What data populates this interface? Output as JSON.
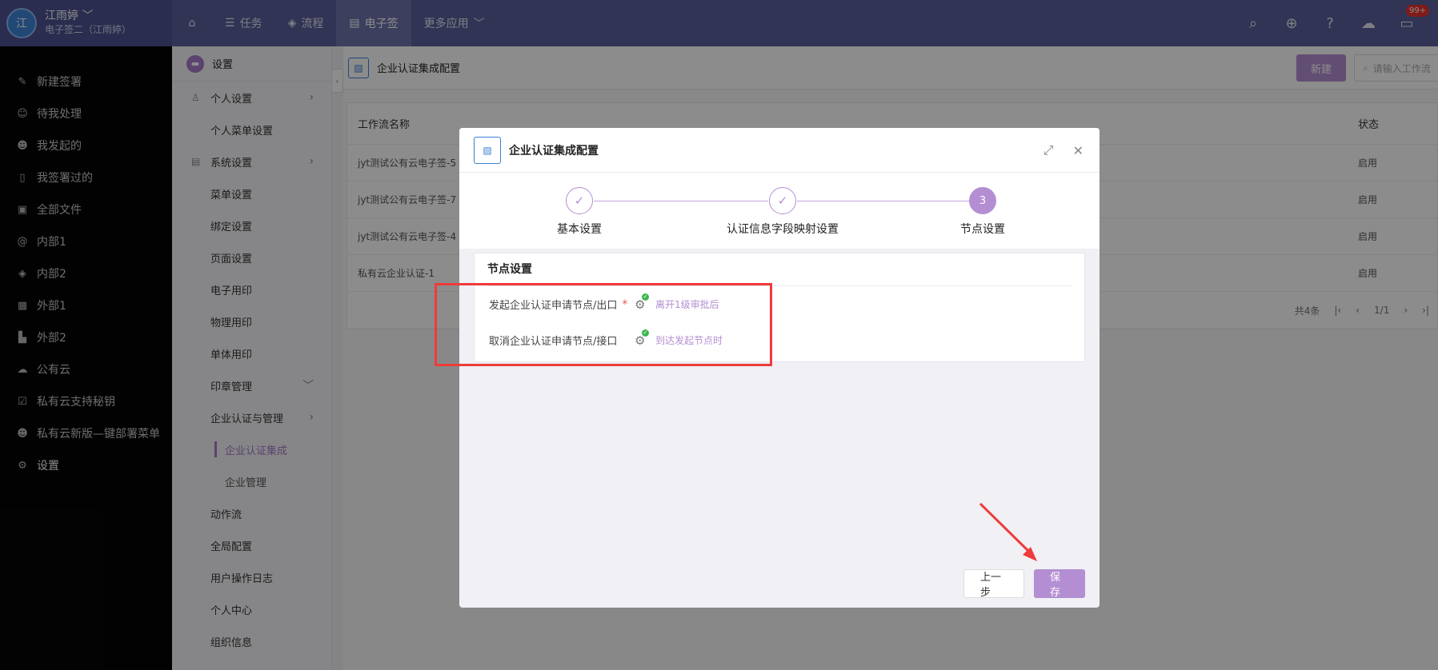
{
  "topbar": {
    "avatar_text": "江",
    "user_name": "江雨婷",
    "user_sub": "电子签二（江雨婷）",
    "nav": [
      {
        "label": ""
      },
      {
        "label": "任务"
      },
      {
        "label": "流程"
      },
      {
        "label": "电子签"
      },
      {
        "label": "更多应用"
      }
    ],
    "notification_badge": "99+"
  },
  "sidebar": {
    "items": [
      {
        "label": "新建签署",
        "icon": "pen-icon"
      },
      {
        "label": "待我处理",
        "icon": "user-clock-icon"
      },
      {
        "label": "我发起的",
        "icon": "user-send-icon"
      },
      {
        "label": "我签署过的",
        "icon": "document-icon"
      },
      {
        "label": "全部文件",
        "icon": "files-icon"
      },
      {
        "label": "内部1",
        "icon": "at-icon"
      },
      {
        "label": "内部2",
        "icon": "layers-icon"
      },
      {
        "label": "外部1",
        "icon": "grid-icon"
      },
      {
        "label": "外部2",
        "icon": "bar-chart-icon"
      },
      {
        "label": "公有云",
        "icon": "cloud-icon"
      },
      {
        "label": "私有云支持秘钥",
        "icon": "checkbox-icon"
      },
      {
        "label": "私有云新版—键部署菜单",
        "icon": "user-settings-icon"
      },
      {
        "label": "设置",
        "icon": "gear-icon"
      }
    ]
  },
  "settings_menu": {
    "header": "设置",
    "items": {
      "personal": "个人设置",
      "personal_menu": "个人菜单设置",
      "system": "系统设置",
      "menu": "菜单设置",
      "binding": "绑定设置",
      "page": "页面设置",
      "e_seal": "电子用印",
      "physical_seal": "物理用印",
      "single_seal": "单体用印",
      "seal_mgmt": "印章管理",
      "enterprise_auth": "企业认证与管理",
      "enterprise_auth_integration": "企业认证集成",
      "enterprise_mgmt": "企业管理",
      "action_flow": "动作流",
      "global_config": "全局配置",
      "user_log": "用户操作日志",
      "personal_center": "个人中心",
      "org_info": "组织信息"
    }
  },
  "main": {
    "title": "企业认证集成配置",
    "new_button": "新建",
    "search_placeholder": "请输入工作流",
    "table": {
      "headers": {
        "name": "工作流名称",
        "status": "状态"
      },
      "rows": [
        {
          "name": "jyt测试公有云电子签-5",
          "status": "启用"
        },
        {
          "name": "jyt测试公有云电子签-7",
          "status": "启用"
        },
        {
          "name": "jyt测试公有云电子签-4",
          "status": "启用"
        },
        {
          "name": "私有云企业认证-1",
          "status": "启用"
        }
      ]
    },
    "pager": {
      "total": "共4条",
      "page": "1/1"
    }
  },
  "modal": {
    "title": "企业认证集成配置",
    "steps": [
      {
        "label": "基本设置",
        "state": "done"
      },
      {
        "label": "认证信息字段映射设置",
        "state": "done"
      },
      {
        "label": "节点设置",
        "state": "current",
        "number": "3"
      }
    ],
    "section_title": "节点设置",
    "nodes": [
      {
        "label": "发起企业认证申请节点/出口",
        "required": "*",
        "value": "离开1级审批后"
      },
      {
        "label": "取消企业认证申请节点/接口",
        "value": "到达发起节点时"
      }
    ],
    "prev_button": "上一步",
    "save_button": "保存"
  },
  "colors": {
    "accent": "#b48ed2",
    "topbar": "#5a5f9a",
    "annotation_red": "#ef3b3b"
  }
}
